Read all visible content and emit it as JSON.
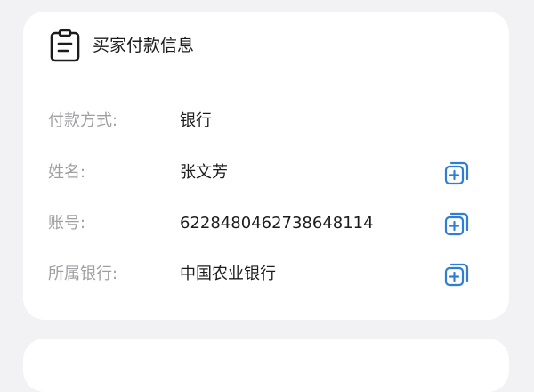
{
  "card": {
    "title": "买家付款信息",
    "rows": [
      {
        "label": "付款方式:",
        "value": "银行",
        "copyable": false
      },
      {
        "label": "姓名:",
        "value": "张文芳",
        "copyable": true
      },
      {
        "label": "账号:",
        "value": "6228480462738648114",
        "copyable": true
      },
      {
        "label": "所属银行:",
        "value": "中国农业银行",
        "copyable": true
      }
    ]
  },
  "icons": {
    "header": "document-list-icon",
    "copy": "copy-icon"
  },
  "colors": {
    "accent": "#2e7ed6",
    "background": "#f2f2f4",
    "label": "#a0a0a4",
    "text": "#1c1c1c"
  }
}
